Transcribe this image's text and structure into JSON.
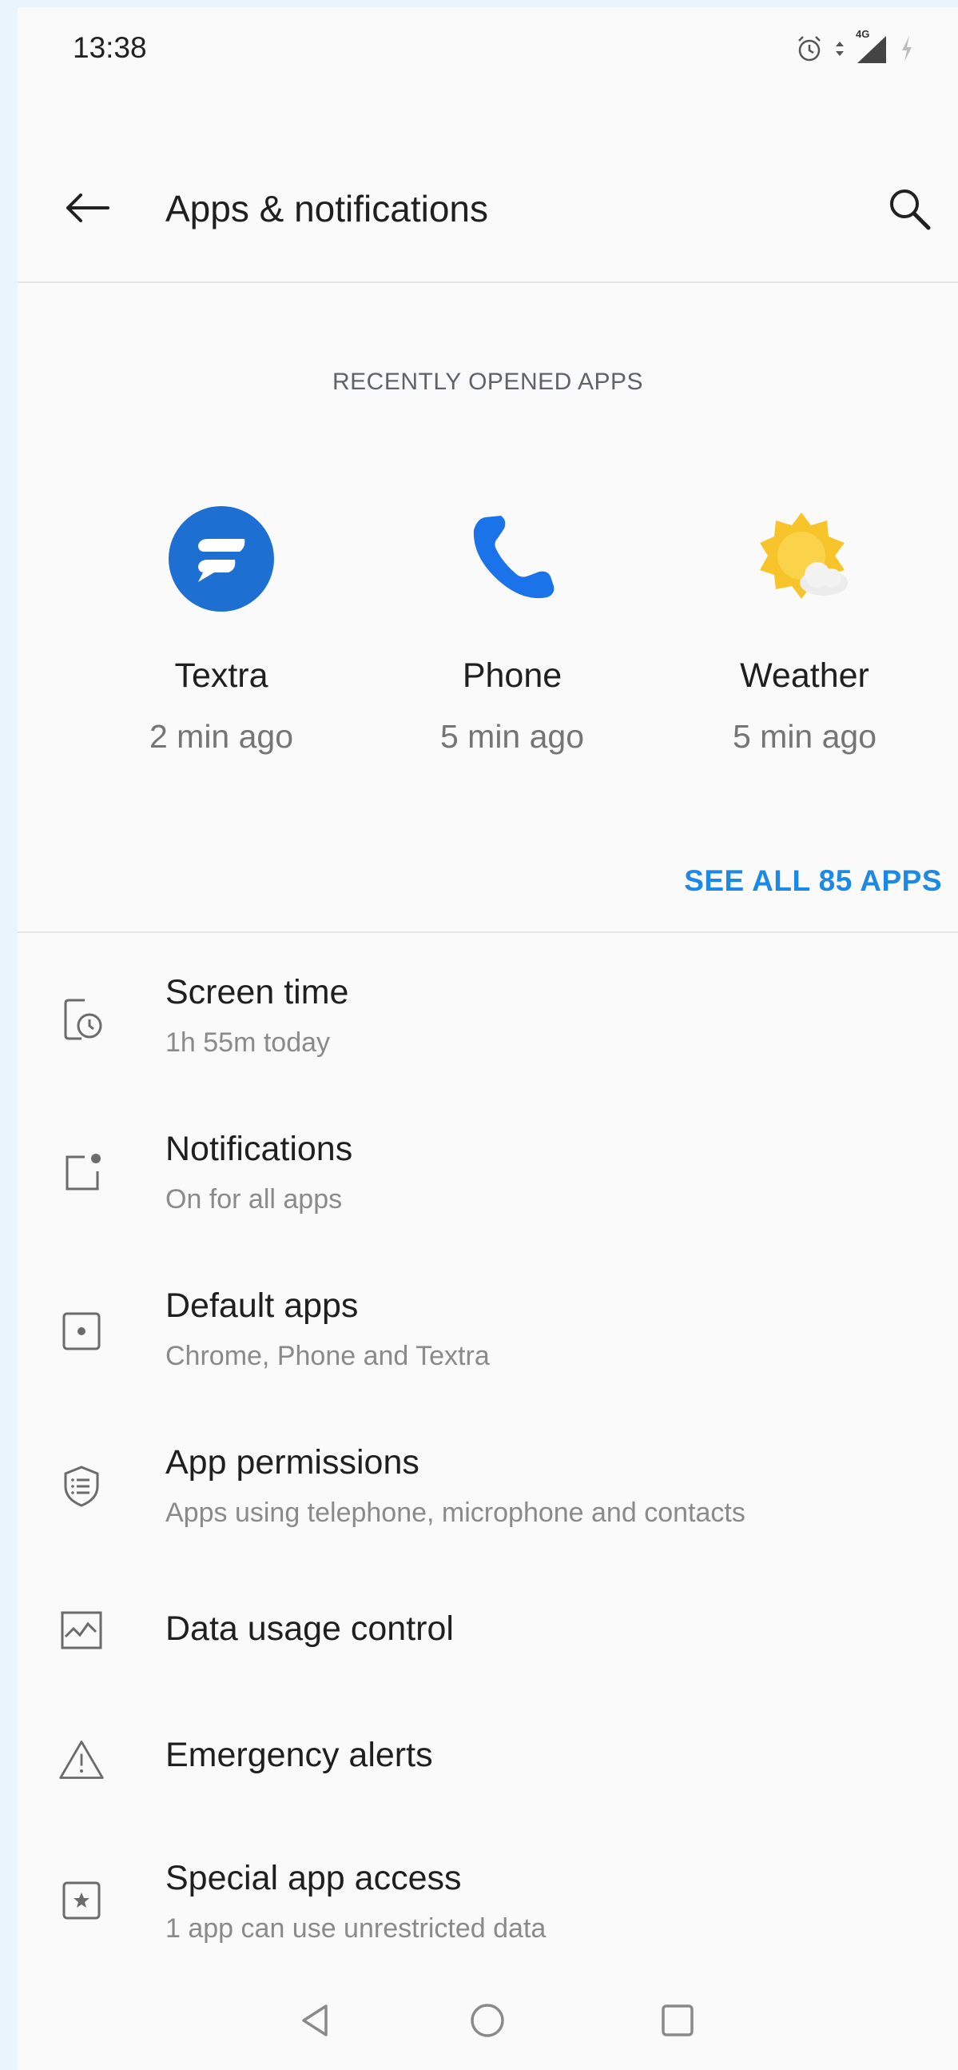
{
  "status_bar": {
    "time": "13:38",
    "network": "4G"
  },
  "app_bar": {
    "title": "Apps & notifications",
    "back_icon": "arrow-back-icon",
    "search_icon": "search-icon"
  },
  "recent": {
    "header": "RECENTLY OPENED APPS",
    "apps": [
      {
        "name": "Textra",
        "time": "2 min ago",
        "icon": "textra-app-icon",
        "color": "#1e6fd2"
      },
      {
        "name": "Phone",
        "time": "5 min ago",
        "icon": "phone-app-icon",
        "color": "#1a73e8"
      },
      {
        "name": "Weather",
        "time": "5 min ago",
        "icon": "weather-app-icon",
        "color": "#f7c52b"
      }
    ],
    "see_all": "SEE ALL 85 APPS"
  },
  "menu": {
    "items": [
      {
        "title": "Screen time",
        "subtitle": "1h 55m today",
        "icon": "screen-time-icon"
      },
      {
        "title": "Notifications",
        "subtitle": "On for all apps",
        "icon": "notifications-icon"
      },
      {
        "title": "Default apps",
        "subtitle": "Chrome, Phone and Textra",
        "icon": "default-apps-icon"
      },
      {
        "title": "App permissions",
        "subtitle": "Apps using telephone, microphone and contacts",
        "icon": "shield-icon"
      },
      {
        "title": "Data usage control",
        "subtitle": "",
        "icon": "data-usage-icon"
      },
      {
        "title": "Emergency alerts",
        "subtitle": "",
        "icon": "warning-icon"
      },
      {
        "title": "Special app access",
        "subtitle": "1 app can use unrestricted data",
        "icon": "special-access-icon"
      }
    ]
  },
  "colors": {
    "accent": "#1e88e5",
    "background": "#fafafa",
    "outer_background": "#e9f4fd",
    "icon_gray": "#6b6b6b"
  }
}
